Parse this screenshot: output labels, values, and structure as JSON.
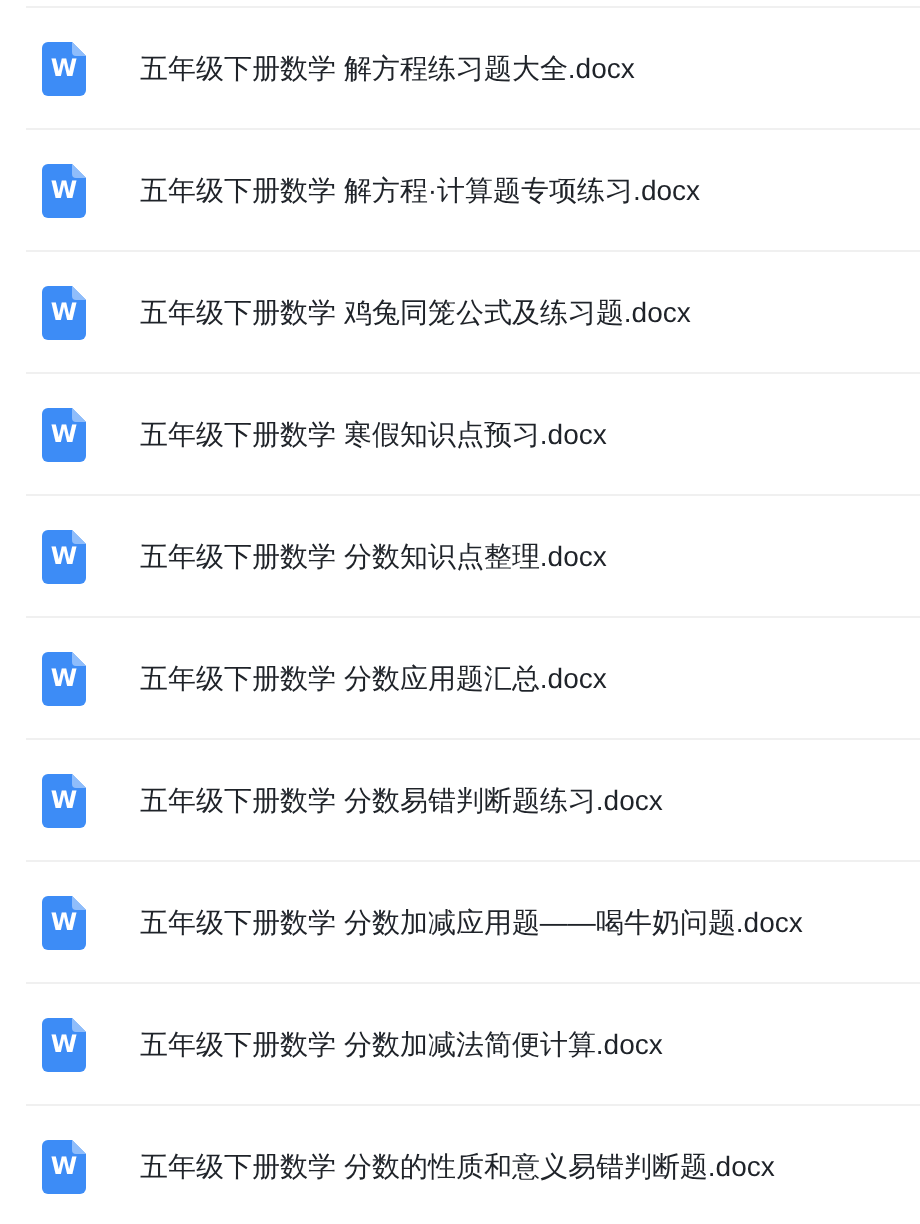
{
  "files": [
    {
      "icon_letter": "W",
      "name": "五年级下册数学 解方程练习题大全.docx"
    },
    {
      "icon_letter": "W",
      "name": "五年级下册数学 解方程·计算题专项练习.docx"
    },
    {
      "icon_letter": "W",
      "name": "五年级下册数学 鸡兔同笼公式及练习题.docx"
    },
    {
      "icon_letter": "W",
      "name": "五年级下册数学 寒假知识点预习.docx"
    },
    {
      "icon_letter": "W",
      "name": "五年级下册数学 分数知识点整理.docx"
    },
    {
      "icon_letter": "W",
      "name": "五年级下册数学 分数应用题汇总.docx"
    },
    {
      "icon_letter": "W",
      "name": "五年级下册数学 分数易错判断题练习.docx"
    },
    {
      "icon_letter": "W",
      "name": "五年级下册数学 分数加减应用题——喝牛奶问题.docx"
    },
    {
      "icon_letter": "W",
      "name": "五年级下册数学 分数加减法简便计算.docx"
    },
    {
      "icon_letter": "W",
      "name": "五年级下册数学 分数的性质和意义易错判断题.docx"
    }
  ]
}
